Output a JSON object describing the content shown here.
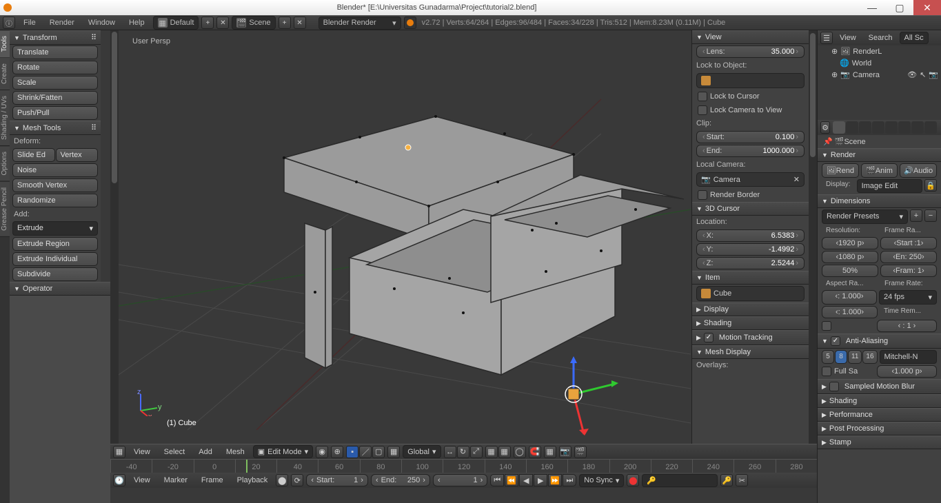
{
  "titlebar": {
    "title": "Blender* [E:\\Universitas Gunadarma\\Project\\tutorial2.blend]"
  },
  "menus": {
    "file": "File",
    "render": "Render",
    "window": "Window",
    "help": "Help"
  },
  "layout": {
    "name": "Default"
  },
  "scene": {
    "name": "Scene"
  },
  "engine": {
    "name": "Blender Render"
  },
  "stats": {
    "text": "v2.72 | Verts:64/264 | Edges:96/484 | Faces:34/228 | Tris:512 | Mem:8.23M (0.11M) | Cube"
  },
  "tabs": {
    "tools": "Tools",
    "create": "Create",
    "shading": "Shading / UVs",
    "options": "Options",
    "grease": "Grease Pencil"
  },
  "transform": {
    "header": "Transform",
    "translate": "Translate",
    "rotate": "Rotate",
    "scale": "Scale",
    "shrink": "Shrink/Fatten",
    "push": "Push/Pull"
  },
  "meshtools": {
    "header": "Mesh Tools",
    "deform": "Deform:",
    "slide": "Slide Ed",
    "vertex": "Vertex",
    "noise": "Noise",
    "smooth": "Smooth Vertex",
    "random": "Randomize",
    "add": "Add:",
    "extrude": "Extrude",
    "extr_reg": "Extrude Region",
    "extr_ind": "Extrude Individual",
    "subdiv": "Subdivide"
  },
  "operator": {
    "header": "Operator"
  },
  "viewport": {
    "persp": "User Persp",
    "objname": "(1) Cube"
  },
  "vp_header": {
    "view": "View",
    "select": "Select",
    "add": "Add",
    "mesh": "Mesh",
    "mode": "Edit Mode",
    "orient": "Global"
  },
  "npanel": {
    "view_h": "View",
    "lens_l": "Lens:",
    "lens_v": "35.000",
    "lockobj": "Lock to Object:",
    "lockcur": "Lock to Cursor",
    "lockcam": "Lock Camera to View",
    "clip": "Clip:",
    "start_l": "Start:",
    "start_v": "0.100",
    "end_l": "End:",
    "end_v": "1000.000",
    "localcam": "Local Camera:",
    "camera": "Camera",
    "rborder": "Render Border",
    "cursor_h": "3D Cursor",
    "location": "Location:",
    "x_l": "X:",
    "x_v": "6.5383",
    "y_l": "Y:",
    "y_v": "-1.4992",
    "z_l": "Z:",
    "z_v": "2.5244",
    "item_h": "Item",
    "item_v": "Cube",
    "display_h": "Display",
    "shading_h": "Shading",
    "motion_h": "Motion Tracking",
    "meshdisp_h": "Mesh Display",
    "overlays": "Overlays:"
  },
  "timeline": {
    "view": "View",
    "marker": "Marker",
    "frame": "Frame",
    "playback": "Playback",
    "start_l": "Start:",
    "start_v": "1",
    "end_l": "End:",
    "end_v": "250",
    "cur_v": "1",
    "sync": "No Sync",
    "ticks": [
      "-40",
      "-20",
      "0",
      "20",
      "40",
      "60",
      "80",
      "100",
      "120",
      "140",
      "160",
      "180",
      "200",
      "220",
      "240",
      "260",
      "280"
    ]
  },
  "outliner": {
    "view": "View",
    "search": "Search",
    "all": "All Sc",
    "renderl": "RenderL",
    "world": "World",
    "camera": "Camera"
  },
  "props": {
    "scene_bc": "Scene",
    "render_h": "Render",
    "rend": "Rend",
    "anim": "Anim",
    "audio": "Audio",
    "display_l": "Display:",
    "display_v": "Image Edit",
    "dim_h": "Dimensions",
    "preset": "Render Presets",
    "res_l": "Resolution:",
    "fr_ra": "Frame Ra...",
    "x": "1920 p",
    "y": "1080 p",
    "pct": "50%",
    "start": "Start :1",
    "end": "En: 250",
    "fram": "Fram: 1",
    "aspect": "Aspect Ra...",
    "frate": "Frame Rate:",
    "ax": ": 1.000",
    "ay": ": 1.000",
    "fps": "24 fps",
    "timerem": "Time Rem...",
    "aa_h": "Anti-Aliasing",
    "s5": "5",
    "s8": "8",
    "s11": "11",
    "s16": "16",
    "mitchell": "Mitchell-N",
    "fullsa": "Full Sa",
    "px": "1.000 p",
    "smb_h": "Sampled Motion Blur",
    "shading_h": "Shading",
    "perf_h": "Performance",
    "post_h": "Post Processing",
    "stamp_h": "Stamp"
  }
}
